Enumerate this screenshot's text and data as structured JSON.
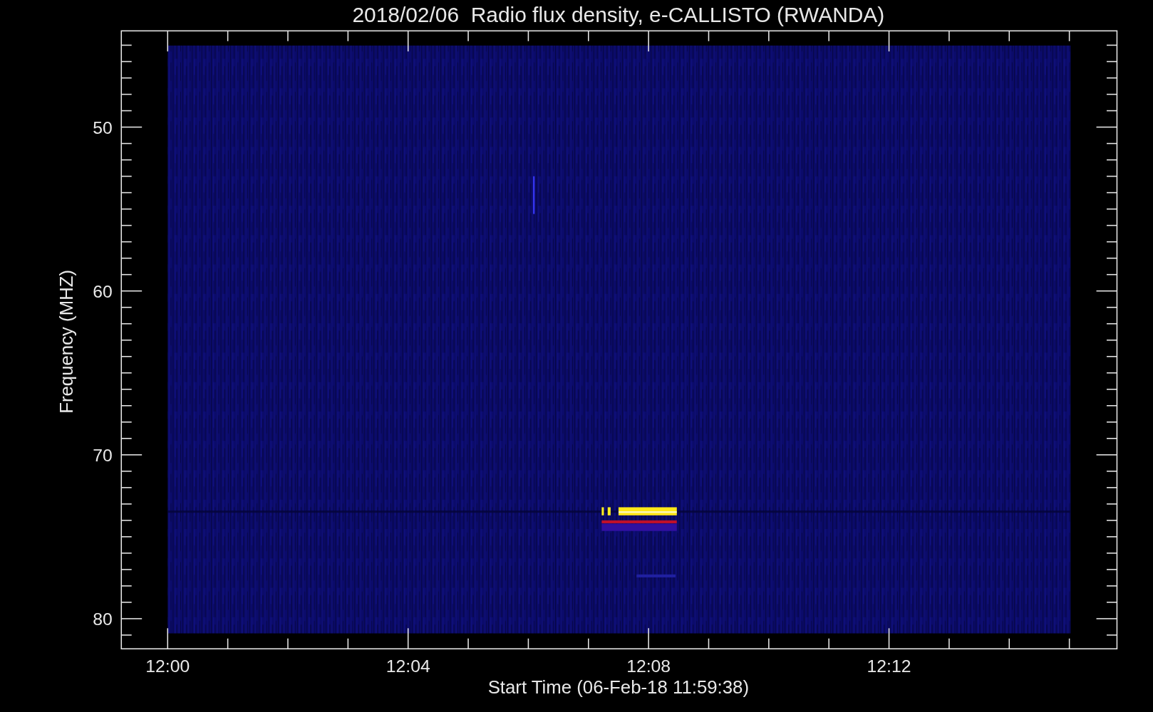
{
  "plot": {
    "title": "2018/02/06  Radio flux density, e-CALLISTO (RWANDA)",
    "ylabel": "Frequency (MHZ)",
    "xlabel": "Start Time (06-Feb-18 11:59:38)",
    "yticks": [
      "50",
      "60",
      "70",
      "80"
    ],
    "xticks": [
      "12:00",
      "12:04",
      "12:08",
      "12:12"
    ]
  }
}
